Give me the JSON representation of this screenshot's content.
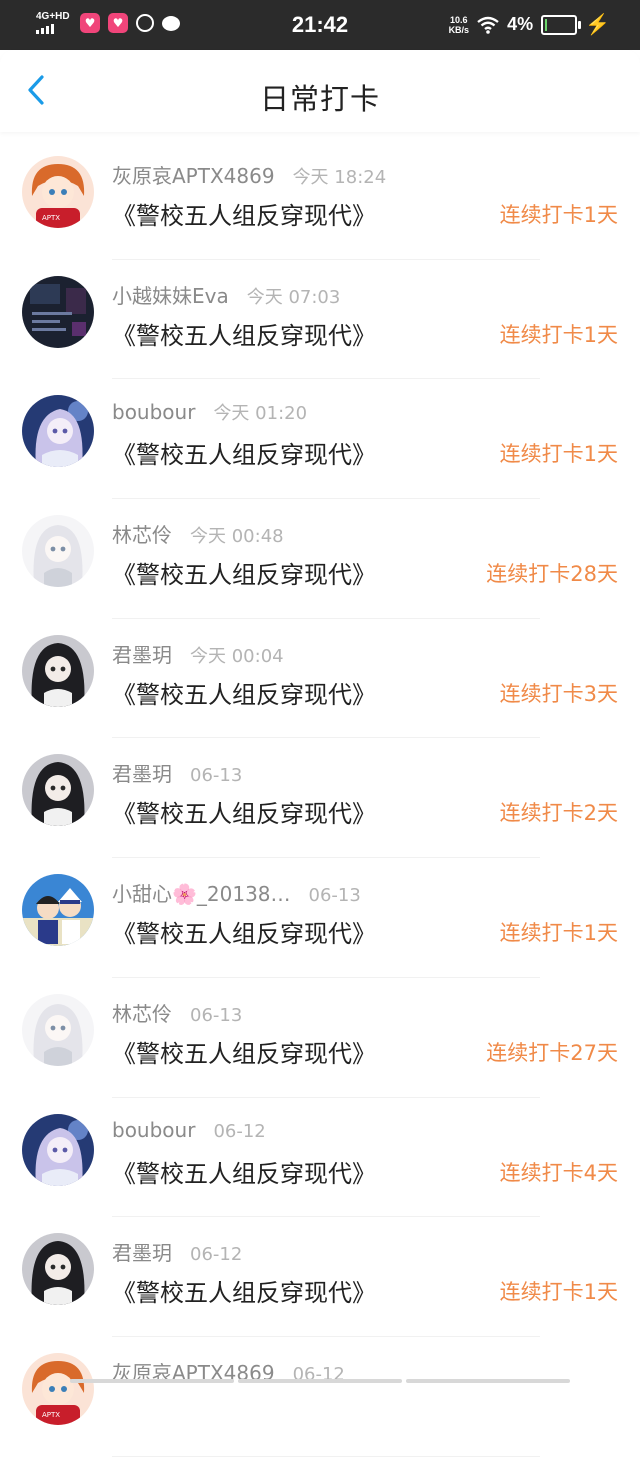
{
  "status_bar": {
    "network": "4G+HD",
    "time": "21:42",
    "speed_value": "10.6",
    "speed_unit": "KB/s",
    "battery": "4%",
    "battery_level": 0.04
  },
  "nav": {
    "title": "日常打卡"
  },
  "entries": [
    {
      "user": "灰原哀APTX4869",
      "time": "今天 18:24",
      "book": "《警校五人组反穿现代》",
      "streak": "连续打卡1天",
      "avatar": "redhair"
    },
    {
      "user": "小越妹妹Eva",
      "time": "今天 07:03",
      "book": "《警校五人组反穿现代》",
      "streak": "连续打卡1天",
      "avatar": "dark"
    },
    {
      "user": "boubour",
      "time": "今天 01:20",
      "book": "《警校五人组反穿现代》",
      "streak": "连续打卡1天",
      "avatar": "bluegirl"
    },
    {
      "user": "林芯伶",
      "time": "今天 00:48",
      "book": "《警校五人组反穿现代》",
      "streak": "连续打卡28天",
      "avatar": "whitegirl"
    },
    {
      "user": "君墨玥",
      "time": "今天 00:04",
      "book": "《警校五人组反穿现代》",
      "streak": "连续打卡3天",
      "avatar": "blackhair"
    },
    {
      "user": "君墨玥",
      "time": "06-13",
      "book": "《警校五人组反穿现代》",
      "streak": "连续打卡2天",
      "avatar": "blackhair"
    },
    {
      "user": "小甜心🌸_20138…",
      "time": "06-13",
      "book": "《警校五人组反穿现代》",
      "streak": "连续打卡1天",
      "avatar": "anime"
    },
    {
      "user": "林芯伶",
      "time": "06-13",
      "book": "《警校五人组反穿现代》",
      "streak": "连续打卡27天",
      "avatar": "whitegirl"
    },
    {
      "user": "boubour",
      "time": "06-12",
      "book": "《警校五人组反穿现代》",
      "streak": "连续打卡4天",
      "avatar": "bluegirl"
    },
    {
      "user": "君墨玥",
      "time": "06-12",
      "book": "《警校五人组反穿现代》",
      "streak": "连续打卡1天",
      "avatar": "blackhair"
    },
    {
      "user": "灰原哀APTX4869",
      "time": "06-12",
      "book": "",
      "streak": "",
      "avatar": "redhair"
    }
  ],
  "colors": {
    "accent": "#1a9be8",
    "streak": "#f08a48",
    "status_bar": "#2b2b2b"
  },
  "icons": {
    "back": "chevron-left-icon"
  }
}
